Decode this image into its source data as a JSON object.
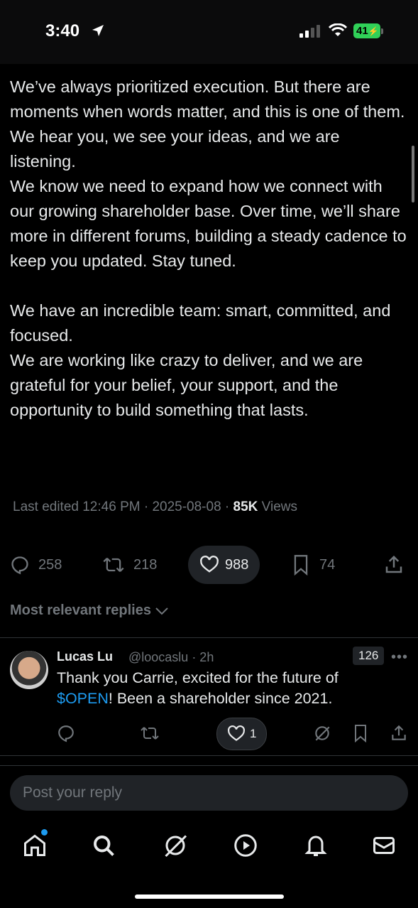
{
  "status": {
    "time": "3:40",
    "battery": "41"
  },
  "post": {
    "paragraphs": [
      "We’ve always prioritized execution. But there are moments when words matter, and this is one of them.",
      "We hear you, we see your ideas, and we are listening.",
      "We know we need to expand how we connect with our growing shareholder base. Over time, we’ll share more in different forums, building a steady cadence to keep you updated. Stay tuned.",
      "",
      "We have an incredible team: smart, committed, and focused.",
      "We are working like crazy to deliver, and we are grateful for your belief, your support, and the opportunity to build something that lasts."
    ],
    "meta": {
      "edited": "Last edited 12:46 PM · 2025-08-08 · ",
      "views_count": "85K",
      "views_label": " Views"
    },
    "actions": {
      "replies": "258",
      "reposts": "218",
      "likes": "988",
      "bookmarks": "74"
    }
  },
  "sort": {
    "label": "Most relevant replies"
  },
  "reply": {
    "name": "Lucas Lu",
    "handle": "@loocaslu · 2h",
    "badge": "126",
    "text_before": "Thank you Carrie, excited for the future of ",
    "cashtag": "$OPEN",
    "text_after": "! Been a shareholder since 2021.",
    "likes": "1"
  },
  "composer": {
    "placeholder": "Post your reply"
  },
  "icons": {
    "reply": "reply-icon",
    "repost": "repost-icon",
    "like": "heart-icon",
    "bookmark": "bookmark-icon",
    "share": "share-icon",
    "tabs": [
      "home-icon",
      "search-icon",
      "grok-icon",
      "video-icon",
      "bell-icon",
      "mail-icon"
    ]
  },
  "colors": {
    "accent": "#1d9bf0",
    "muted": "#71767b",
    "text": "#e7e9ea",
    "battery": "#30d158"
  }
}
